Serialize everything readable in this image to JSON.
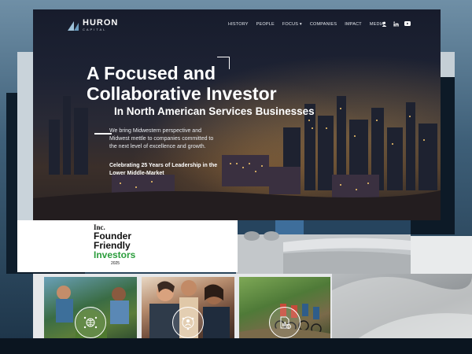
{
  "header": {
    "logo_main": "HURON",
    "logo_sub": "CAPITAL",
    "nav": [
      "HISTORY",
      "PEOPLE",
      "FOCUS",
      "COMPANIES",
      "IMPACT",
      "MEDIA"
    ],
    "social_icons": [
      "user-icon",
      "linkedin-icon",
      "youtube-icon"
    ]
  },
  "hero": {
    "headline_line1": "A Focused and",
    "headline_line2": "Collaborative Investor",
    "subheadline": "In North American Services Businesses",
    "paragraph": "We bring Midwestern perspective and Midwest mettle to companies committed to the next level of excellence and growth.",
    "celebrate": "Celebrating 25 Years of Leadership in the Lower Middle-Market"
  },
  "award": {
    "inc": "Inc.",
    "line1": "Founder",
    "line2": "Friendly",
    "line3": "Investors",
    "year": "2025"
  },
  "cards": [
    {
      "icon": "globe-network-icon"
    },
    {
      "icon": "people-network-icon"
    },
    {
      "icon": "document-chart-icon"
    }
  ],
  "colors": {
    "accent_green": "#2b9d3c",
    "hero_dark": "#171c2c"
  }
}
